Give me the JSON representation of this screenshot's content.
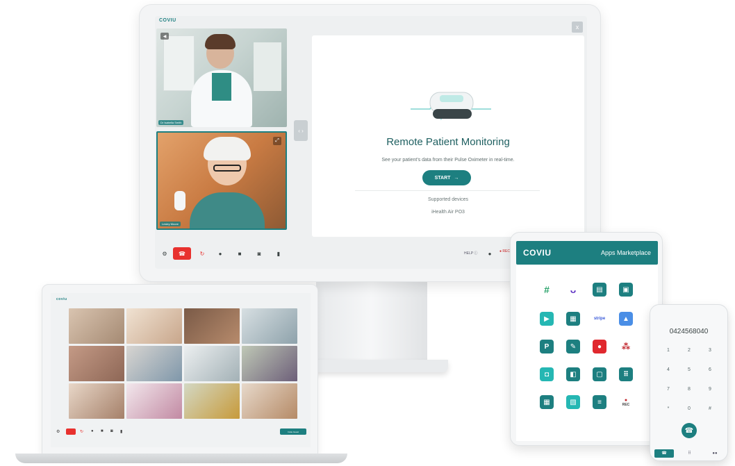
{
  "colors": {
    "brand": "#1d7f80",
    "end_call": "#e8312e"
  },
  "monitor": {
    "brand": "COVIU",
    "close_icon": "x",
    "doctor_label": "Dr Isabella Smith",
    "patient_label": "Lesley Moore",
    "rpm": {
      "title": "Remote Patient Monitoring",
      "description": "See your patient's data from their Pulse Oximeter in real-time.",
      "start_label": "START",
      "supported_label": "Supported devices",
      "device_name": "iHealth Air PO3"
    },
    "toolbar": {
      "icons": [
        "settings-icon",
        "end-call-icon",
        "refresh-icon",
        "microphone-icon",
        "camera-icon",
        "snapshot-icon",
        "trash-icon"
      ],
      "help_label": "HELP",
      "rec_label": "REC"
    }
  },
  "laptop": {
    "brand": "coviu",
    "right_button_label": "Invite Guest"
  },
  "tablet": {
    "brand": "COVIU",
    "title": "Apps Marketplace",
    "rec_label": "REC"
  },
  "phone": {
    "number": "0424568040",
    "keys": [
      "1",
      "2",
      "3",
      "4",
      "5",
      "6",
      "7",
      "8",
      "9",
      "*",
      "0",
      "#"
    ]
  }
}
